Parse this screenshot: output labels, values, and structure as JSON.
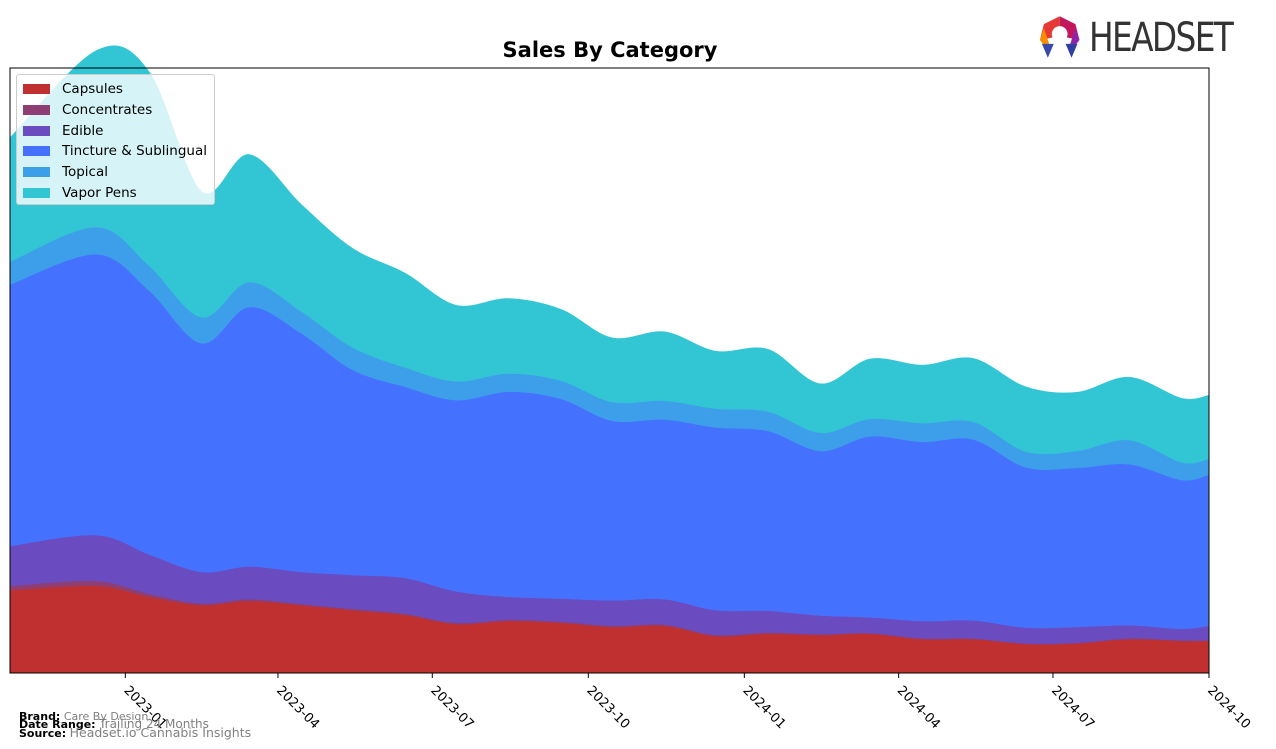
{
  "chart_data": {
    "type": "area",
    "title": "Sales By Category",
    "xlabel": "",
    "ylabel": "",
    "stacked": true,
    "grid": false,
    "legend_position": "top-left",
    "x_tick_labels": [
      "2023-01",
      "2023-04",
      "2023-07",
      "2023-10",
      "2024-01",
      "2024-04",
      "2024-07",
      "2024-10"
    ],
    "x": [
      "2022-11",
      "2022-12",
      "2023-01",
      "2023-02",
      "2023-03",
      "2023-04",
      "2023-05",
      "2023-06",
      "2023-07",
      "2023-08",
      "2023-09",
      "2023-10",
      "2023-11",
      "2023-12",
      "2024-01",
      "2024-02",
      "2024-03",
      "2024-04",
      "2024-05",
      "2024-06",
      "2024-07",
      "2024-08",
      "2024-09",
      "2024-10"
    ],
    "ylim": [
      0,
      100
    ],
    "y_units": "relative (share of plot height; no y-axis shown)",
    "series": [
      {
        "name": "Capsules",
        "color": "#c03030",
        "values": [
          13.7,
          14.4,
          12.6,
          11.2,
          11.9,
          11.2,
          10.4,
          9.6,
          8.1,
          8.6,
          8.3,
          7.6,
          7.8,
          6.1,
          6.5,
          6.3,
          6.5,
          5.6,
          5.6,
          4.8,
          4.9,
          5.6,
          5.3,
          5.3
        ]
      },
      {
        "name": "Concentrates",
        "color": "#8e3e72",
        "values": [
          0.7,
          0.8,
          0.5,
          0.3,
          0.3,
          0.2,
          0.2,
          0.2,
          0.2,
          0.2,
          0.2,
          0.2,
          0.2,
          0.2,
          0.2,
          0.1,
          0.1,
          0.1,
          0.1,
          0.1,
          0.1,
          0.1,
          0.1,
          0.1
        ]
      },
      {
        "name": "Edible",
        "color": "#6a4bc0",
        "values": [
          6.6,
          7.6,
          6.5,
          5.2,
          5.4,
          5.3,
          5.6,
          5.9,
          5.2,
          3.8,
          3.8,
          4.2,
          4.2,
          4.1,
          3.6,
          3.1,
          2.6,
          2.9,
          3.0,
          2.6,
          2.6,
          2.2,
          1.9,
          2.4
        ]
      },
      {
        "name": "Tincture & Sublingual",
        "color": "#4472ff",
        "values": [
          43.2,
          46.4,
          43.6,
          37.8,
          42.9,
          39.4,
          33.9,
          31.6,
          31.6,
          33.9,
          33.0,
          29.7,
          29.7,
          30.2,
          29.7,
          27.2,
          29.9,
          29.6,
          29.9,
          26.5,
          26.3,
          26.6,
          24.6,
          25.0
        ]
      },
      {
        "name": "Topical",
        "color": "#3d9eea",
        "values": [
          3.8,
          4.5,
          4.1,
          4.3,
          4.1,
          3.6,
          3.7,
          3.2,
          3.1,
          3.0,
          3.0,
          3.1,
          3.1,
          3.1,
          3.2,
          3.0,
          2.9,
          3.1,
          2.9,
          2.6,
          2.8,
          4.0,
          2.9,
          2.6
        ]
      },
      {
        "name": "Vapor Pens",
        "color": "#32c5d4",
        "values": [
          20.5,
          29.2,
          32.1,
          20.8,
          21.1,
          17.7,
          16.4,
          15.6,
          12.6,
          12.4,
          11.8,
          10.6,
          11.4,
          9.5,
          10.3,
          8.1,
          9.9,
          9.6,
          10.5,
          10.7,
          9.7,
          10.4,
          10.6,
          10.5
        ]
      }
    ]
  },
  "legend": {
    "items": [
      {
        "label": "Capsules",
        "color": "#c03030"
      },
      {
        "label": "Concentrates",
        "color": "#8e3e72"
      },
      {
        "label": "Edible",
        "color": "#6a4bc0"
      },
      {
        "label": "Tincture & Sublingual",
        "color": "#4472ff"
      },
      {
        "label": "Topical",
        "color": "#3d9eea"
      },
      {
        "label": "Vapor Pens",
        "color": "#32c5d4"
      }
    ]
  },
  "logo": {
    "text": "HEADSET"
  },
  "footer": {
    "brand_label": "Brand:",
    "brand_value": "Care By Design",
    "date_range_label": "Date Range:",
    "date_range_value": "Trailing 24 Months",
    "source_label": "Source:",
    "source_value": "Headset.io Cannabis Insights"
  }
}
